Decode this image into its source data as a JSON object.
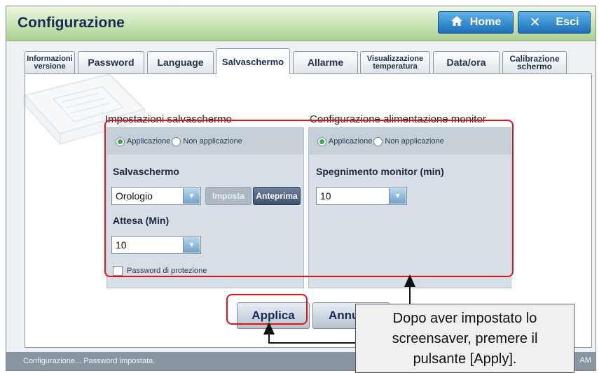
{
  "header": {
    "title": "Configurazione",
    "home_label": "Home",
    "exit_label": "Esci"
  },
  "tabs": [
    {
      "label": "Informazioni versione",
      "l1": "Informazioni",
      "l2": "versione",
      "active": false
    },
    {
      "label": "Password",
      "active": false
    },
    {
      "label": "Language",
      "active": false
    },
    {
      "label": "Salvaschermo",
      "active": true
    },
    {
      "label": "Allarme",
      "active": false
    },
    {
      "label": "Visualizzazione temperatura",
      "l1": "Visualizzazione",
      "l2": "temperatura",
      "active": false
    },
    {
      "label": "Data/ora",
      "active": false
    },
    {
      "label": "Calibrazione schermo",
      "l1": "Calibrazione",
      "l2": "schermo",
      "active": false
    }
  ],
  "screensaver": {
    "section_title": "Impostazioni salvaschermo",
    "radio_apply": "Applicazione",
    "radio_not_apply": "Non applicazione",
    "radio_selected": "Applicazione",
    "saver_label": "Salvaschermo",
    "saver_value": "Orologio",
    "set_button": "Imposta",
    "preview_button": "Anteprima",
    "wait_label": "Attesa (Min)",
    "wait_value": "10",
    "password_checkbox": "Password di protezione",
    "password_checked": false
  },
  "monitor": {
    "section_title": "Configurazione alimentazione monitor",
    "radio_apply": "Applicazione",
    "radio_not_apply": "Non applicazione",
    "radio_selected": "Applicazione",
    "off_label": "Spegnimento monitor (min)",
    "off_value": "10"
  },
  "actions": {
    "apply_label": "Applica",
    "cancel_label": "Annu"
  },
  "status": {
    "message": "Configurazione... Password impostata.",
    "clock": "AM"
  },
  "callout": {
    "line1": "Dopo aver impostato lo",
    "line2": "screensaver, premere il",
    "line3": "pulsante [Apply]."
  },
  "colors": {
    "highlight": "#e0141e",
    "active_radio": "#3aa84a",
    "title_bar": "#c9e3b3",
    "button_blue": "#1d6fb8"
  }
}
